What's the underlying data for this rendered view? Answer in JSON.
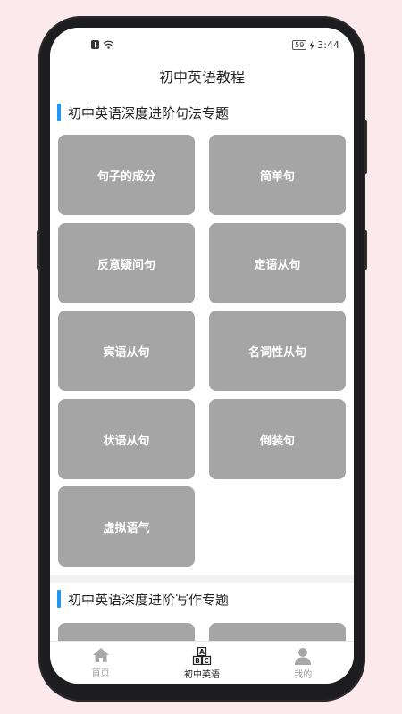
{
  "status": {
    "battery": "59",
    "time": "3:44"
  },
  "header": {
    "title": "初中英语教程"
  },
  "sections": [
    {
      "title": "初中英语深度进阶句法专题",
      "items": [
        "句子的成分",
        "简单句",
        "反意疑问句",
        "定语从句",
        "宾语从句",
        "名词性从句",
        "状语从句",
        "倒装句",
        "虚拟语气"
      ]
    },
    {
      "title": "初中英语深度进阶写作专题",
      "items": [
        "",
        ""
      ]
    }
  ],
  "tabs": [
    {
      "label": "首页",
      "icon": "home-icon"
    },
    {
      "label": "初中英语",
      "icon": "abc-blocks-icon"
    },
    {
      "label": "我的",
      "icon": "person-icon"
    }
  ],
  "colors": {
    "accent": "#2196f3",
    "tile": "#a5a5a5",
    "background": "#fbe9ec"
  }
}
